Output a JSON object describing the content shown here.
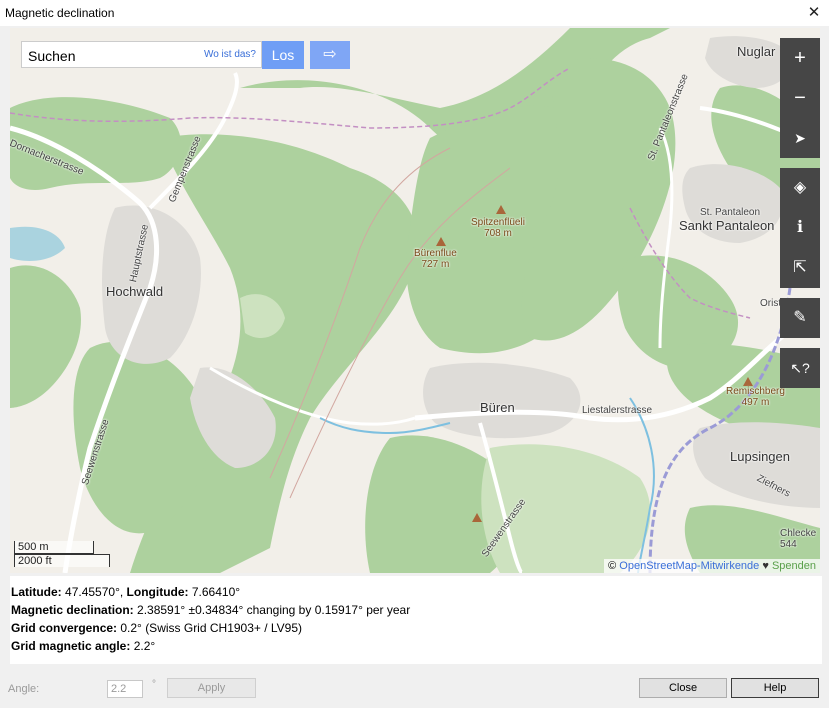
{
  "window": {
    "title": "Magnetic declination",
    "close_glyph": "✕"
  },
  "map": {
    "search_value": "Suchen",
    "where_label": "Wo ist das?",
    "go_label": "Los",
    "route_icon": "route-arrow-icon",
    "controls": [
      {
        "name": "zoom-in-button",
        "glyph": "+"
      },
      {
        "name": "zoom-out-button",
        "glyph": "−"
      },
      {
        "name": "locate-button",
        "glyph": "➤"
      }
    ],
    "controls2": [
      {
        "name": "layers-button",
        "glyph": "◈"
      },
      {
        "name": "info-button",
        "glyph": "ℹ"
      },
      {
        "name": "share-button",
        "glyph": "⇱"
      }
    ],
    "note_glyph": "✎",
    "query_glyph": "↖?",
    "labels": {
      "nuglar": "Nuglar",
      "dornacherstrasse": "Dornacherstrasse",
      "gempenstrasse": "Gempenstrasse",
      "hauptstrasse": "Hauptstrasse",
      "hochwald": "Hochwald",
      "spitzenflueli": "Spitzenflüeli",
      "spitzenflueli_ele": "708 m",
      "buerenflue": "Bürenflue",
      "buerenflue_ele": "727 m",
      "st_pantaleonstrasse": "St. Pantaleonstrasse",
      "st_pantaleon": "St. Pantaleon",
      "sankt_pantaleon": "Sankt Pantaleon",
      "oristalstrasse": "Oristalstrasse",
      "bueren": "Büren",
      "liestalerstrasse": "Liestalerstrasse",
      "remischberg": "Remischberg",
      "remischberg_ele": "497 m",
      "lupsingen": "Lupsingen",
      "ziefnerst": "Ziefners",
      "seewenstrasse": "Seewenstrasse",
      "seewenstrasse2": "Seewenstrasse",
      "chlecke": "Chlecke",
      "chlecke_ele": "544"
    },
    "scale": {
      "metric": "500 m",
      "imperial": "2000 ft"
    },
    "attribution": {
      "copyright": "©",
      "osm": "OpenStreetMap-Mitwirkende",
      "heart": "♥",
      "donate": "Spenden"
    }
  },
  "info": {
    "lat_label": "Latitude:",
    "lat_value": "47.45570°,",
    "lon_label": "Longitude:",
    "lon_value": "7.66410°",
    "decl_label": "Magnetic declination:",
    "decl_value": "2.38591° ±0.34834° changing by 0.15917° per year",
    "conv_label": "Grid convergence:",
    "conv_value": "0.2° (Swiss Grid  CH1903+ / LV95)",
    "gma_label": "Grid magnetic angle:",
    "gma_value": "2.2°"
  },
  "footer": {
    "angle_label": "Angle:",
    "angle_value": "2.2",
    "degree": "°",
    "apply": "Apply",
    "close": "Close",
    "help": "Help"
  }
}
